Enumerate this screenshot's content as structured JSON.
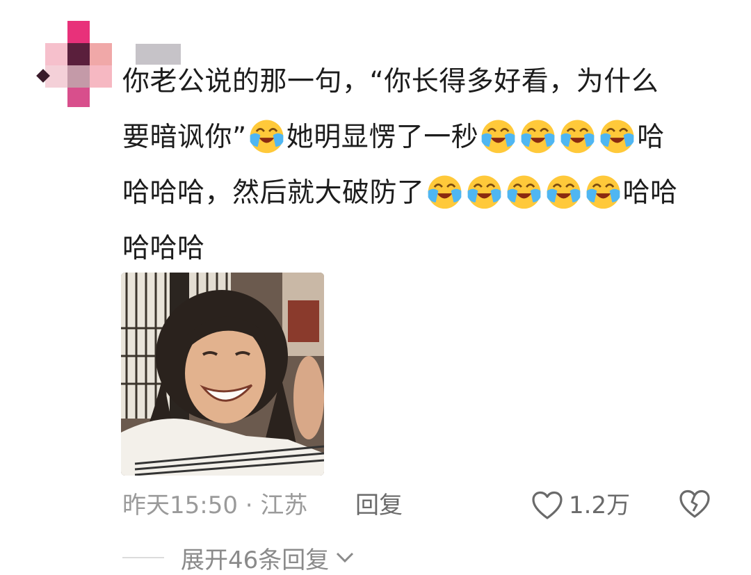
{
  "comment": {
    "lines": [
      [
        {
          "t": "你老公说的那一句，“你长得多好看，为什么"
        }
      ],
      [
        {
          "t": "要暗讽你”"
        },
        {
          "e": 1
        },
        {
          "t": "她明显愣了一秒"
        },
        {
          "e": 4
        },
        {
          "t": "哈"
        }
      ],
      [
        {
          "t": "哈哈哈，然后就大破防了"
        },
        {
          "e": 5
        },
        {
          "t": "哈哈"
        }
      ],
      [
        {
          "t": "哈哈哈"
        }
      ]
    ],
    "emoji_name": "laughing-crying-emoji"
  },
  "meta": {
    "time_location": "昨天15:50 · 江苏",
    "reply_label": "回复",
    "like_count": "1.2万"
  },
  "expand": {
    "label": "展开46条回复"
  },
  "colors": {
    "avatar_pink": "#e8317a",
    "avatar_light": "#f4b0c0",
    "avatar_dark": "#5a1f3c",
    "emoji_yellow": "#ffc93a",
    "tear_blue": "#4fb6f2"
  }
}
